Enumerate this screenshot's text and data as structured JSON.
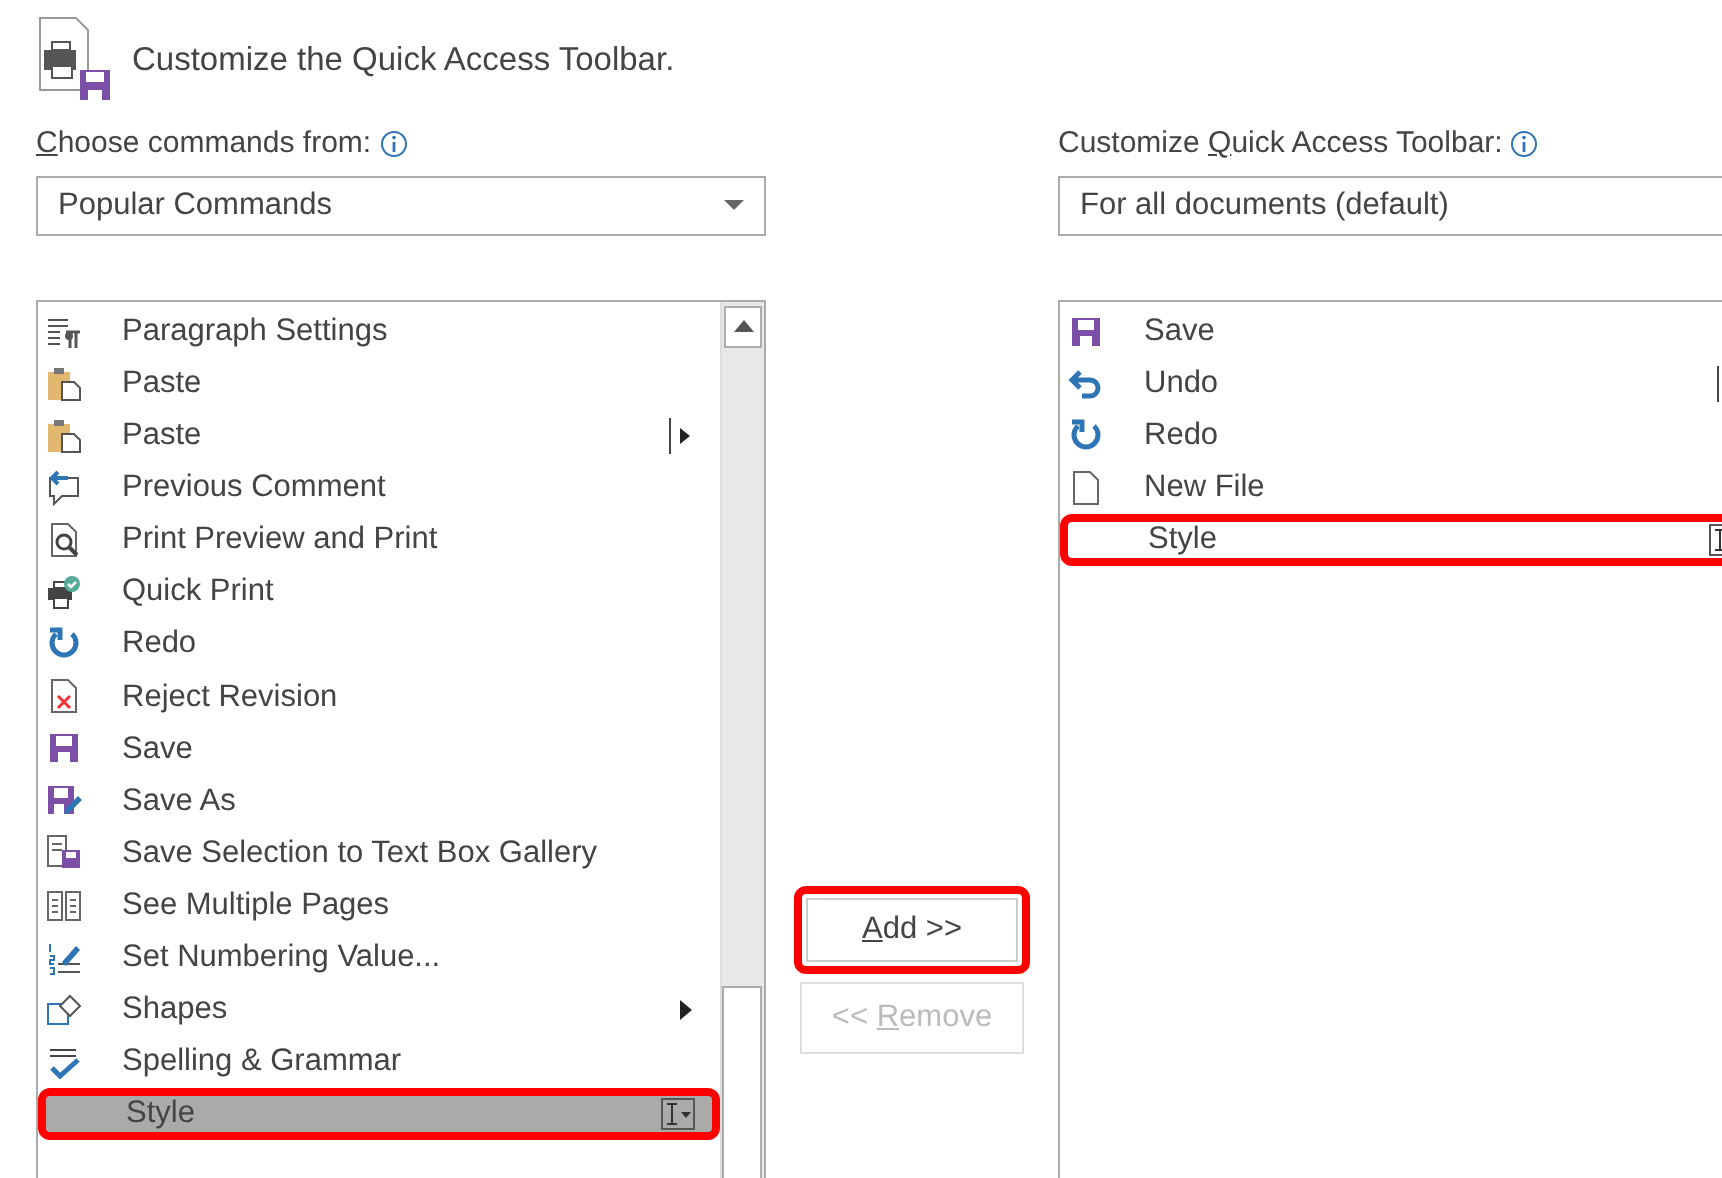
{
  "header": {
    "title": "Customize the Quick Access Toolbar."
  },
  "source": {
    "label": {
      "key": "C",
      "after": "hoose commands from:"
    },
    "dropdown": "Popular Commands",
    "commands": [
      {
        "text": "Paragraph Settings",
        "kind": "plain",
        "selected": false,
        "highlighted": false
      },
      {
        "text": "Paste",
        "kind": "plain",
        "selected": false,
        "highlighted": false
      },
      {
        "text": "Paste",
        "kind": "split",
        "selected": false,
        "highlighted": false
      },
      {
        "text": "Previous Comment",
        "kind": "plain",
        "selected": false,
        "highlighted": false
      },
      {
        "text": "Print Preview and Print",
        "kind": "plain",
        "selected": false,
        "highlighted": false
      },
      {
        "text": "Quick Print",
        "kind": "plain",
        "selected": false,
        "highlighted": false
      },
      {
        "text": "Redo",
        "kind": "plain",
        "selected": false,
        "highlighted": false
      },
      {
        "text": "Reject Revision",
        "kind": "plain",
        "selected": false,
        "highlighted": false
      },
      {
        "text": "Save",
        "kind": "plain",
        "selected": false,
        "highlighted": false
      },
      {
        "text": "Save As",
        "kind": "plain",
        "selected": false,
        "highlighted": false
      },
      {
        "text": "Save Selection to Text Box Gallery",
        "kind": "plain",
        "selected": false,
        "highlighted": false
      },
      {
        "text": "See Multiple Pages",
        "kind": "plain",
        "selected": false,
        "highlighted": false
      },
      {
        "text": "Set Numbering Value...",
        "kind": "plain",
        "selected": false,
        "highlighted": false
      },
      {
        "text": "Shapes",
        "kind": "submenu",
        "selected": false,
        "highlighted": false
      },
      {
        "text": "Spelling & Grammar",
        "kind": "plain",
        "selected": false,
        "highlighted": false
      },
      {
        "text": "Style",
        "kind": "combo",
        "selected": true,
        "highlighted": true
      }
    ]
  },
  "actions": [
    {
      "key": "A",
      "after": "dd >>",
      "disabled": false,
      "highlighted": true
    },
    {
      "before": "<< ",
      "key": "R",
      "after": "emove",
      "disabled": true,
      "highlighted": false
    }
  ],
  "toolbar": {
    "label": {
      "before": "Customize ",
      "key": "Q",
      "after": "uick Access Toolbar:"
    },
    "dropdown": "For all documents (default)",
    "commands": [
      {
        "text": "Save",
        "kind": "plain",
        "selected": false,
        "highlighted": false
      },
      {
        "text": "Undo",
        "kind": "split",
        "selected": false,
        "highlighted": false
      },
      {
        "text": "Redo",
        "kind": "plain",
        "selected": false,
        "highlighted": false
      },
      {
        "text": "New File",
        "kind": "plain",
        "selected": false,
        "highlighted": false
      },
      {
        "text": "Style",
        "kind": "combo",
        "selected": false,
        "highlighted": true
      }
    ]
  }
}
